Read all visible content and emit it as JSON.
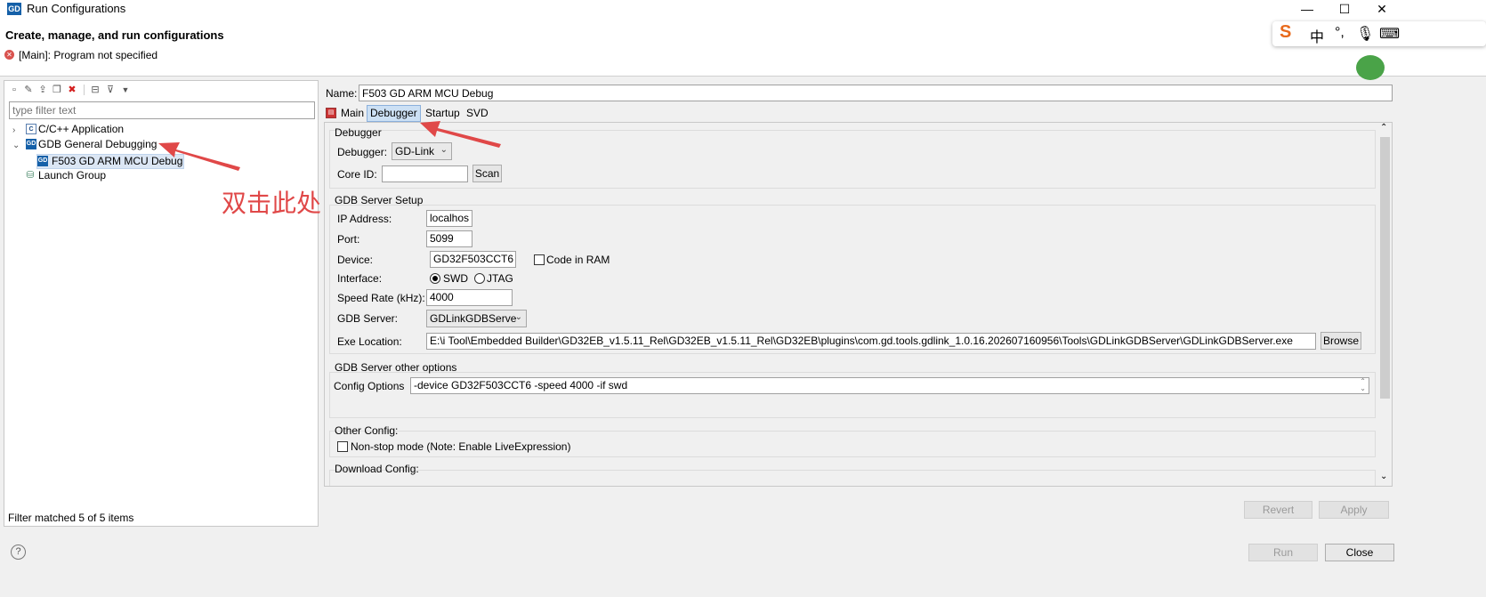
{
  "window": {
    "app_icon": "GD",
    "title": "Run Configurations",
    "controls": [
      "—",
      "☐",
      "✕"
    ]
  },
  "header": {
    "title": "Create, manage, and run configurations",
    "message": "[Main]: Program not specified",
    "error_icon": "error-icon"
  },
  "ime": {
    "items": [
      "S",
      "中",
      "°,",
      "🎙",
      "⌨"
    ]
  },
  "left": {
    "toolbar_icons": [
      "new-config-icon",
      "new-prototype-icon",
      "export-icon",
      "duplicate-icon",
      "delete-icon",
      "collapse-all-icon",
      "filter-icon",
      "view-menu-icon"
    ],
    "filter_placeholder": "type filter text",
    "tree": [
      {
        "label": "C/C++ Application",
        "icon": "C",
        "twisty": "›"
      },
      {
        "label": "GDB General Debugging",
        "icon": "GD",
        "twisty": "⌄"
      },
      {
        "label": "F503 GD ARM MCU Debug",
        "icon": "GD"
      },
      {
        "label": "Launch Group",
        "icon": ""
      }
    ],
    "status": "Filter matched 5 of 5 items"
  },
  "annotation": {
    "text": "双击此处"
  },
  "config": {
    "name_label": "Name:",
    "name_value": "F503 GD ARM MCU Debug",
    "tabs": [
      "Main",
      "Debugger",
      "Startup",
      "SVD"
    ],
    "active_tab": "Debugger",
    "debugger_group": {
      "title": "Debugger",
      "debugger_label": "Debugger:",
      "debugger_value": "GD-Link",
      "core_id_label": "Core ID:",
      "core_id_value": "",
      "scan_label": "Scan"
    },
    "gdb_server_setup": {
      "title": "GDB Server Setup",
      "ip_label": "IP Address:",
      "ip_value": "localhos",
      "port_label": "Port:",
      "port_value": "5099",
      "device_label": "Device:",
      "device_value": "GD32F503CCT6",
      "code_in_ram_label": "Code in RAM",
      "interface_label": "Interface:",
      "swd_label": "SWD",
      "jtag_label": "JTAG",
      "speed_label": "Speed Rate (kHz):",
      "speed_value": "4000",
      "gdb_server_label": "GDB Server:",
      "gdb_server_value": "GDLinkGDBServe",
      "exe_label": "Exe Location:",
      "exe_value": "E:\\i Tool\\Embedded Builder\\GD32EB_v1.5.11_Rel\\GD32EB_v1.5.11_Rel\\GD32EB\\plugins\\com.gd.tools.gdlink_1.0.16.202607160956\\Tools\\GDLinkGDBServer\\GDLinkGDBServer.exe",
      "browse_label": "Browse"
    },
    "gdb_other": {
      "title": "GDB Server other options",
      "config_label": "Config Options",
      "config_value": "-device GD32F503CCT6 -speed 4000 -if swd"
    },
    "other_config": {
      "title": "Other Config:",
      "nonstop_label": "Non-stop mode (Note: Enable LiveExpression)"
    },
    "download_config": {
      "title": "Download Config:"
    }
  },
  "buttons": {
    "revert": "Revert",
    "apply": "Apply",
    "run": "Run",
    "close": "Close",
    "help": "?"
  },
  "colors": {
    "accent": "#1560a8",
    "annotation": "#e04848",
    "selection": "#dbe6f4"
  }
}
